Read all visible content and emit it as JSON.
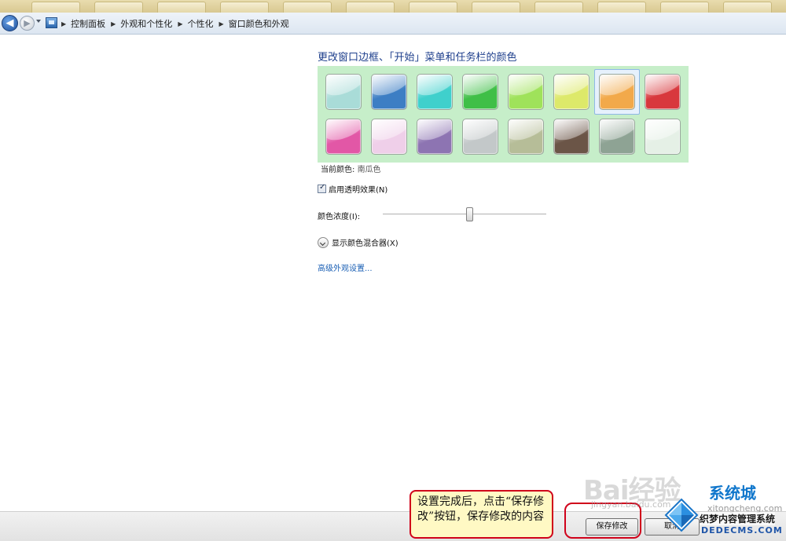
{
  "breadcrumb": [
    "控制面板",
    "外观和个性化",
    "个性化",
    "窗口颜色和外观"
  ],
  "page_title": "更改窗口边框、「开始」菜单和任务栏的颜色",
  "palette": {
    "selected_index": 6,
    "swatches": [
      {
        "name": "sky",
        "color": "#a9dcd8"
      },
      {
        "name": "twilight",
        "color": "#3d7ec4"
      },
      {
        "name": "sea",
        "color": "#3fd0cc"
      },
      {
        "name": "leaf",
        "color": "#3fbf47"
      },
      {
        "name": "lime",
        "color": "#9fe25a"
      },
      {
        "name": "lemon",
        "color": "#dde96a"
      },
      {
        "name": "pumpkin",
        "color": "#f2a94a"
      },
      {
        "name": "ruby",
        "color": "#d8383d"
      },
      {
        "name": "fuchsia",
        "color": "#e257a6"
      },
      {
        "name": "blush",
        "color": "#efcfe9"
      },
      {
        "name": "violet",
        "color": "#8d74b2"
      },
      {
        "name": "lavender",
        "color": "#c3c8c9"
      },
      {
        "name": "taupe",
        "color": "#b6bd98"
      },
      {
        "name": "chocolate",
        "color": "#6b5547"
      },
      {
        "name": "slate",
        "color": "#8ea394"
      },
      {
        "name": "frost",
        "color": "#e5f0e6"
      }
    ]
  },
  "current_color": {
    "label": "当前颜色:",
    "value": "南瓜色"
  },
  "transparency": {
    "label": "启用透明效果(N)",
    "checked": true
  },
  "intensity": {
    "label": "颜色浓度(I):",
    "value_fraction": 0.53
  },
  "mixer": {
    "label": "显示颜色混合器(X)"
  },
  "advanced_link": "高级外观设置...",
  "buttons": {
    "save": "保存修改",
    "cancel": "取消"
  },
  "callout_text": "设置完成后，点击“保存修改”按钮，保存修改的内容",
  "watermarks": {
    "baidu": "Bai经验",
    "jingyan": "jingyan.baidu.com",
    "xitongcheng": "系统城",
    "xitongcheng_sub": "xitongcheng.com",
    "dede": "织梦内容管理系统",
    "dede_url": "DEDECMS.COM"
  },
  "colors": {
    "link": "#1a5fb4",
    "title": "#1e3f8c",
    "palette_bg": "#c6eec9",
    "highlight": "#d0021b"
  }
}
